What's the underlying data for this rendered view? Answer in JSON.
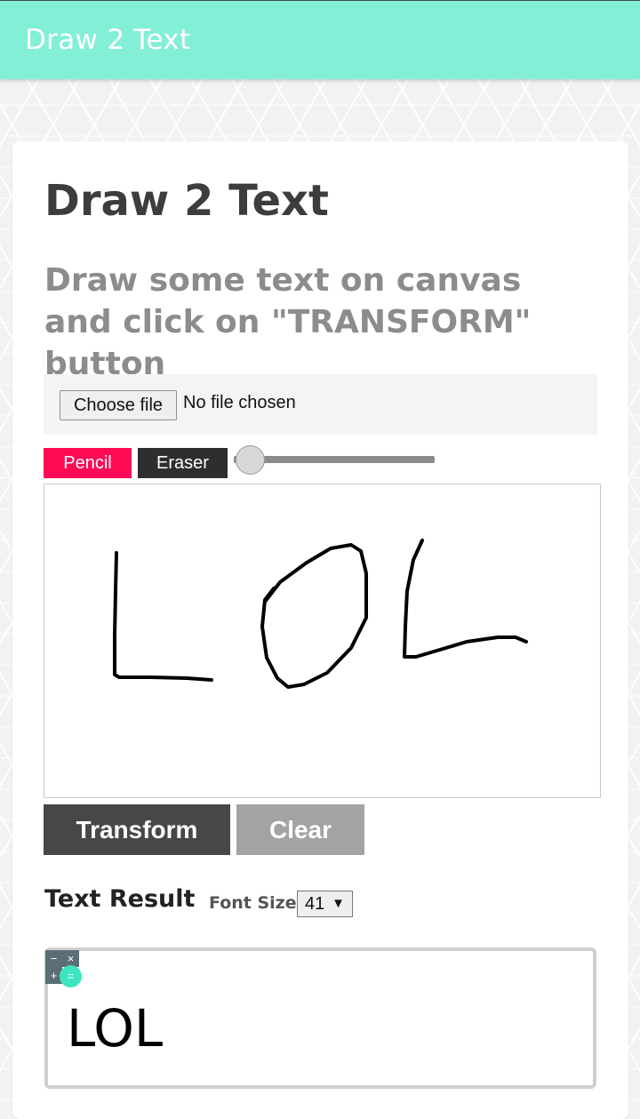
{
  "header": {
    "title": "Draw 2 Text"
  },
  "main": {
    "title": "Draw 2 Text",
    "subtitle": "Draw some text on canvas and click on \"TRANSFORM\" button",
    "file_input": {
      "button_label": "Choose file",
      "status": "No file chosen"
    },
    "tools": {
      "pencil_label": "Pencil",
      "eraser_label": "Eraser",
      "brush_size": 0
    },
    "actions": {
      "transform_label": "Transform",
      "clear_label": "Clear"
    },
    "result": {
      "title": "Text Result",
      "font_size_label": "Font Size",
      "font_size_value": "41",
      "text": "LOL"
    }
  },
  "calc_widget": {
    "minus": "−",
    "times": "×",
    "plus": "+",
    "equals": "="
  },
  "colors": {
    "header_bg": "#83efd7",
    "pencil_bg": "#ff0a55",
    "eraser_bg": "#2e2e2e",
    "transform_bg": "#474747",
    "clear_bg": "#a3a3a3"
  }
}
